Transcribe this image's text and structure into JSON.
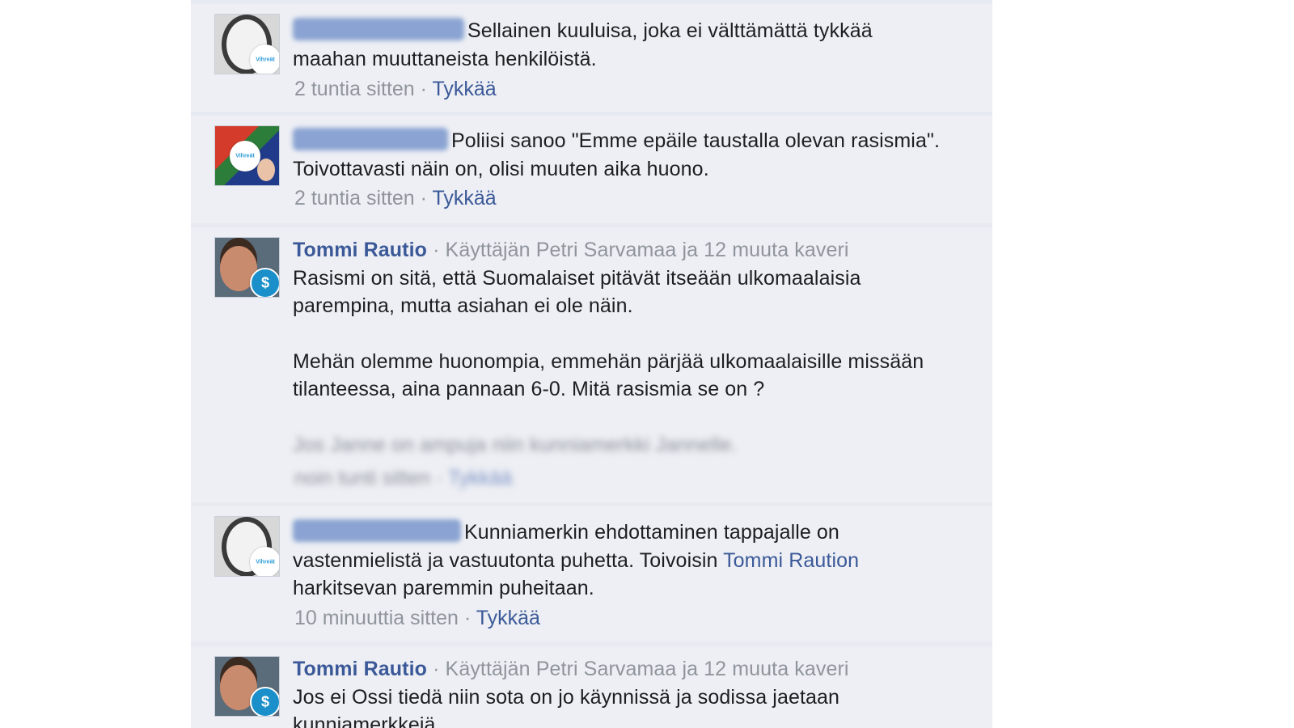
{
  "comments": [
    {
      "author_blurred": true,
      "text": "Sellainen kuuluisa, joka ei välttämättä tykkää maahan muuttaneista henkilöistä.",
      "time": "2 tuntia sitten",
      "like": "Tykkää"
    },
    {
      "author_blurred": true,
      "text": "Poliisi sanoo \"Emme epäile taustalla olevan rasismia\". Toivottavasti näin on, olisi muuten aika huono.",
      "time": "2 tuntia sitten",
      "like": "Tykkää"
    },
    {
      "author": "Tommi Rautio",
      "meta": "Käyttäjän Petri Sarvamaa ja 12 muuta kaveri",
      "paragraph1": "Rasismi on sitä, että Suomalaiset pitävät itseään ulkomaalaisia parempina, mutta asiahan ei ole näin.",
      "paragraph2": "Mehän olemme huonompia, emmehän pärjää ulkomaalaisille missään tilanteessa, aina pannaan 6-0. Mitä rasismia se on ?",
      "paragraph3_blurred": "Jos Janne on ampuja niin kunniamerkki Jannelle.",
      "time_blurred": "noin tunti sitten",
      "like": "Tykkää"
    },
    {
      "author_blurred": true,
      "text_start": "Kunniamerkin ehdottaminen tappajalle on vastenmielistä ja vastuutonta puhetta. Toivoisin ",
      "mention": "Tommi Raution",
      "text_end": " harkitsevan paremmin puheitaan.",
      "time": "10 minuuttia sitten",
      "like": "Tykkää"
    },
    {
      "author": "Tommi Rautio",
      "meta": "Käyttäjän Petri Sarvamaa ja 12 muuta kaveri",
      "text": "Jos ei Ossi tiedä niin sota on jo käynnissä ja sodissa jaetaan kunniamerkkejä."
    }
  ],
  "separator": "·",
  "badge_label": "Vihreät",
  "badge_symbol": "$",
  "colors": {
    "link": "#3b5998",
    "meta": "#90949c",
    "comment_bg": "#edeff4"
  }
}
